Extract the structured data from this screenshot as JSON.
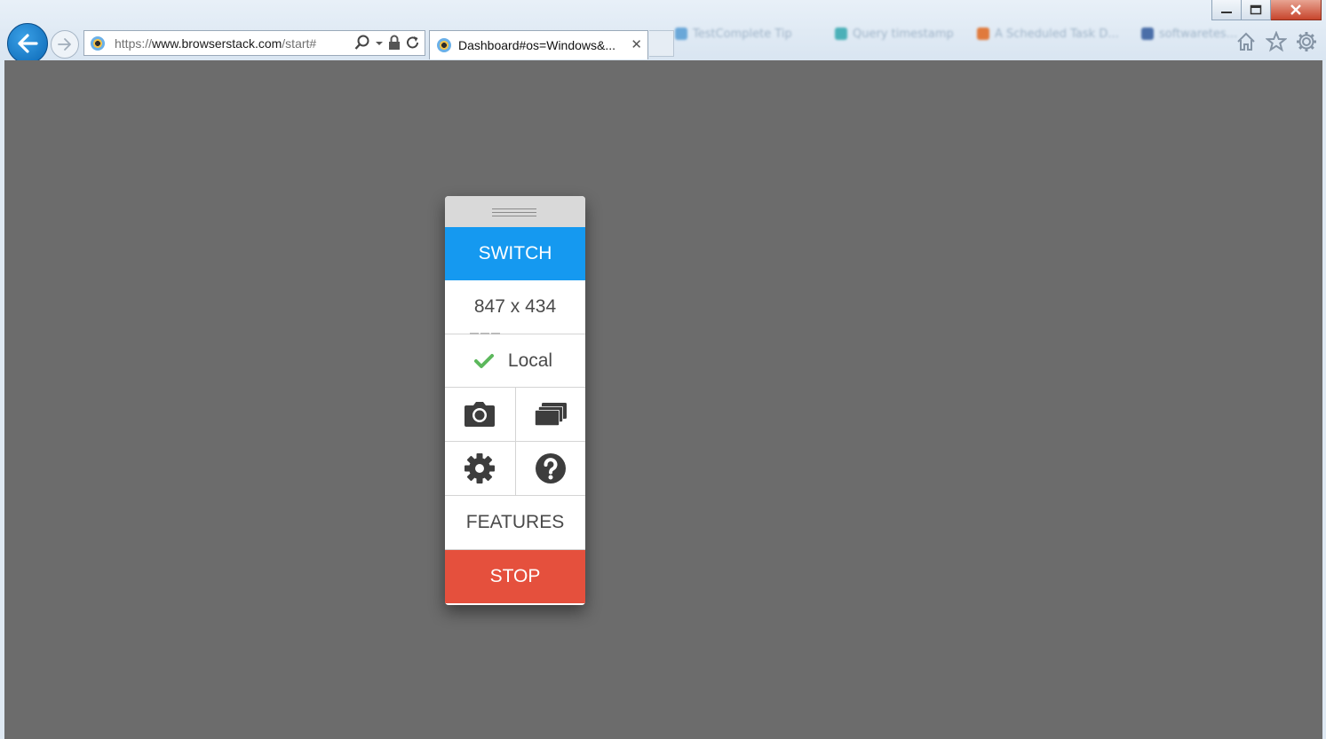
{
  "browser": {
    "url_prefix": "https://",
    "url_host": "www.browserstack.com",
    "url_path": "/start#",
    "active_tab_title": "Dashboard#os=Windows&...",
    "background_tabs": [
      "TestComplete Tip",
      "Query timestamp",
      "A Scheduled Task D...",
      "softwaretes..."
    ]
  },
  "panel": {
    "switch_label": "SWITCH",
    "resolution": "847 x 434",
    "local_label": "Local",
    "features_label": "FEATURES",
    "stop_label": "STOP"
  },
  "colors": {
    "switch": "#1599f0",
    "stop": "#e5503d",
    "check": "#5cb85c",
    "canvas": "#6c6c6c"
  },
  "icons": [
    "camera-icon",
    "gallery-icon",
    "gear-icon",
    "help-icon",
    "check-icon"
  ]
}
